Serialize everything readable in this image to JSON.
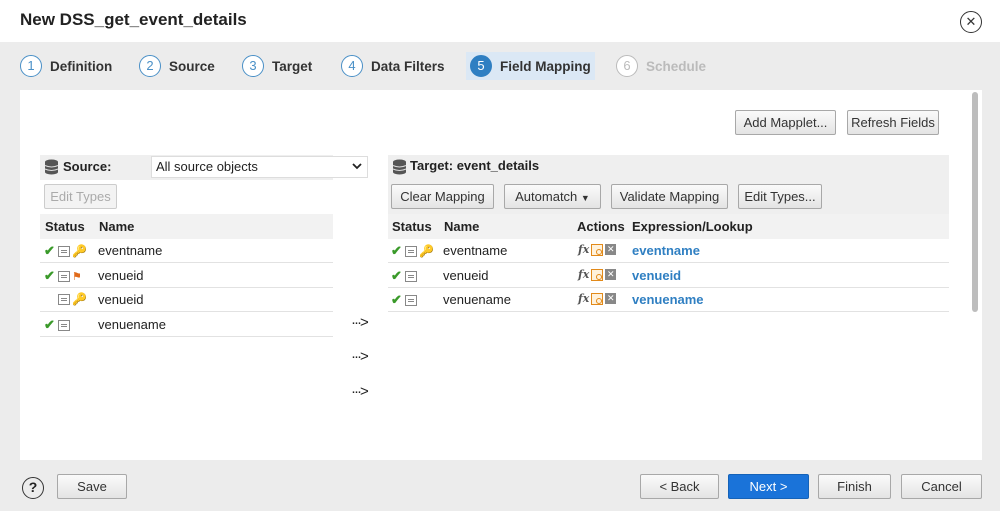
{
  "window": {
    "title": "New DSS_get_event_details",
    "close_icon": "close-icon"
  },
  "steps": [
    {
      "num": "1",
      "label": "Definition"
    },
    {
      "num": "2",
      "label": "Source"
    },
    {
      "num": "3",
      "label": "Target"
    },
    {
      "num": "4",
      "label": "Data Filters"
    },
    {
      "num": "5",
      "label": "Field Mapping",
      "active": true
    },
    {
      "num": "6",
      "label": "Schedule",
      "disabled": true
    }
  ],
  "toolbar": {
    "add_mapplet": "Add Mapplet...",
    "refresh_fields": "Refresh Fields"
  },
  "source": {
    "label": "Source:",
    "selected": "All source objects",
    "edit_types": "Edit Types",
    "columns": {
      "status": "Status",
      "name": "Name"
    },
    "rows": [
      {
        "name": "eventname"
      },
      {
        "name": "venueid"
      },
      {
        "name": "venueid"
      },
      {
        "name": "venuename"
      }
    ]
  },
  "target": {
    "label": "Target: event_details",
    "clear_mapping": "Clear Mapping",
    "automatch": "Automatch",
    "validate_mapping": "Validate Mapping",
    "edit_types": "Edit Types...",
    "columns": {
      "status": "Status",
      "name": "Name",
      "actions": "Actions",
      "expression": "Expression/Lookup"
    },
    "rows": [
      {
        "name": "eventname",
        "fx": "fx",
        "expression": "eventname"
      },
      {
        "name": "venueid",
        "fx": "fx",
        "expression": "venueid"
      },
      {
        "name": "venuename",
        "fx": "fx",
        "expression": "venuename"
      }
    ]
  },
  "arrows": [
    "···>",
    "···>",
    "···>"
  ],
  "footer": {
    "help": "?",
    "save": "Save",
    "back": "< Back",
    "next": "Next >",
    "finish": "Finish",
    "cancel": "Cancel"
  },
  "colors": {
    "accent": "#2f7fc2",
    "primary_button": "#1a73d9",
    "check": "#3a9a2a"
  }
}
